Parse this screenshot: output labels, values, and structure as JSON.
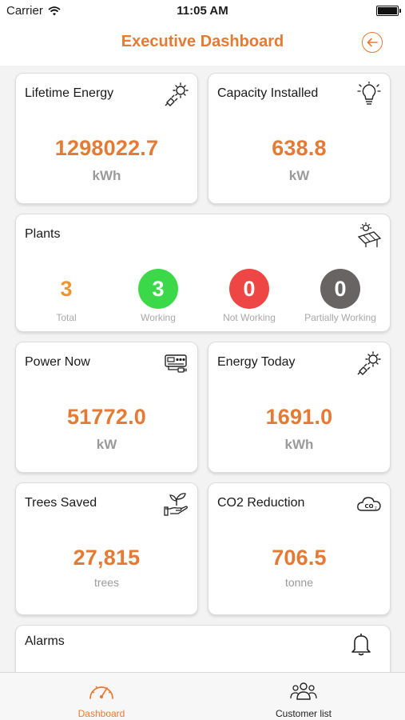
{
  "status_bar": {
    "carrier": "Carrier",
    "time": "11:05 AM"
  },
  "header": {
    "title": "Executive Dashboard",
    "back_icon": "arrow-left-circle-icon"
  },
  "colors": {
    "accent": "#e57a35",
    "working": "#3bd94a",
    "not_working": "#ee4545",
    "partial": "#686464",
    "unit_gray": "#9a9a9a"
  },
  "cards": {
    "lifetime_energy": {
      "title": "Lifetime Energy",
      "value": "1298022.7",
      "unit": "kWh",
      "icon": "sun-plug-icon"
    },
    "capacity_installed": {
      "title": "Capacity Installed",
      "value": "638.8",
      "unit": "kW",
      "icon": "lightbulb-icon"
    },
    "power_now": {
      "title": "Power Now",
      "value": "51772.0",
      "unit": "kW",
      "icon": "power-meter-icon"
    },
    "energy_today": {
      "title": "Energy Today",
      "value": "1691.0",
      "unit": "kWh",
      "icon": "sun-plug-icon"
    },
    "trees_saved": {
      "title": "Trees Saved",
      "value": "27,815",
      "unit": "trees",
      "icon": "plant-hand-icon"
    },
    "co2_reduction": {
      "title": "CO2 Reduction",
      "value": "706.5",
      "unit": "tonne",
      "icon": "co2-cloud-icon"
    }
  },
  "plants": {
    "title": "Plants",
    "icon": "solar-panel-icon",
    "stats": [
      {
        "value": "3",
        "label": "Total"
      },
      {
        "value": "3",
        "label": "Working"
      },
      {
        "value": "0",
        "label": "Not Working"
      },
      {
        "value": "0",
        "label": "Partially Working"
      }
    ]
  },
  "alarms": {
    "title": "Alarms",
    "icon": "bell-icon"
  },
  "tab_bar": {
    "items": [
      {
        "label": "Dashboard",
        "icon": "speedometer-icon",
        "active": true
      },
      {
        "label": "Customer list",
        "icon": "users-group-icon",
        "active": false
      }
    ]
  }
}
